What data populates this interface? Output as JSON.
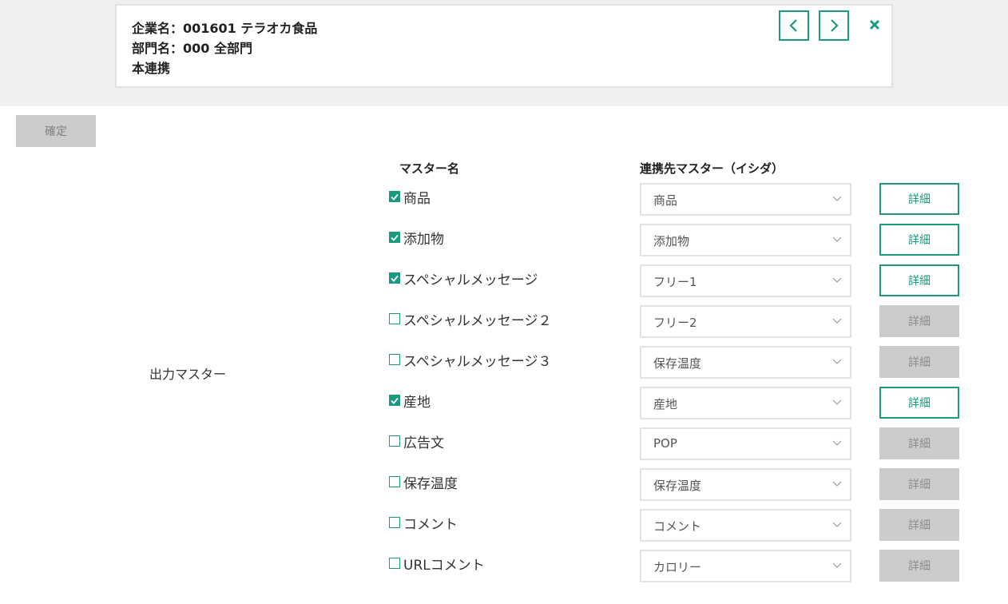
{
  "header": {
    "company_line": "企業名：001601 テラオカ食品",
    "department_line": "部門名：000 全部門",
    "mode_line": "本連携"
  },
  "nav": {
    "prev_icon": "chevron-left-icon",
    "next_icon": "chevron-right-icon",
    "close_icon": "close-icon"
  },
  "colors": {
    "accent": "#1a9a7e",
    "disabled": "#cccccc",
    "band": "#efefef"
  },
  "toolbar": {
    "confirm_label": "確定"
  },
  "table": {
    "section_label": "出力マスター",
    "col_master": "マスター名",
    "col_target": "連携先マスター（イシダ）",
    "detail_label": "詳細",
    "rows": [
      {
        "label": "商品",
        "checked": true,
        "target": "商品"
      },
      {
        "label": "添加物",
        "checked": true,
        "target": "添加物"
      },
      {
        "label": "スペシャルメッセージ",
        "checked": true,
        "target": "フリー1"
      },
      {
        "label": "スペシャルメッセージ２",
        "checked": false,
        "target": "フリー2"
      },
      {
        "label": "スペシャルメッセージ３",
        "checked": false,
        "target": "保存温度"
      },
      {
        "label": "産地",
        "checked": true,
        "target": "産地"
      },
      {
        "label": "広告文",
        "checked": false,
        "target": "POP"
      },
      {
        "label": "保存温度",
        "checked": false,
        "target": "保存温度"
      },
      {
        "label": "コメント",
        "checked": false,
        "target": "コメント"
      },
      {
        "label": "URLコメント",
        "checked": false,
        "target": "カロリー"
      }
    ]
  }
}
